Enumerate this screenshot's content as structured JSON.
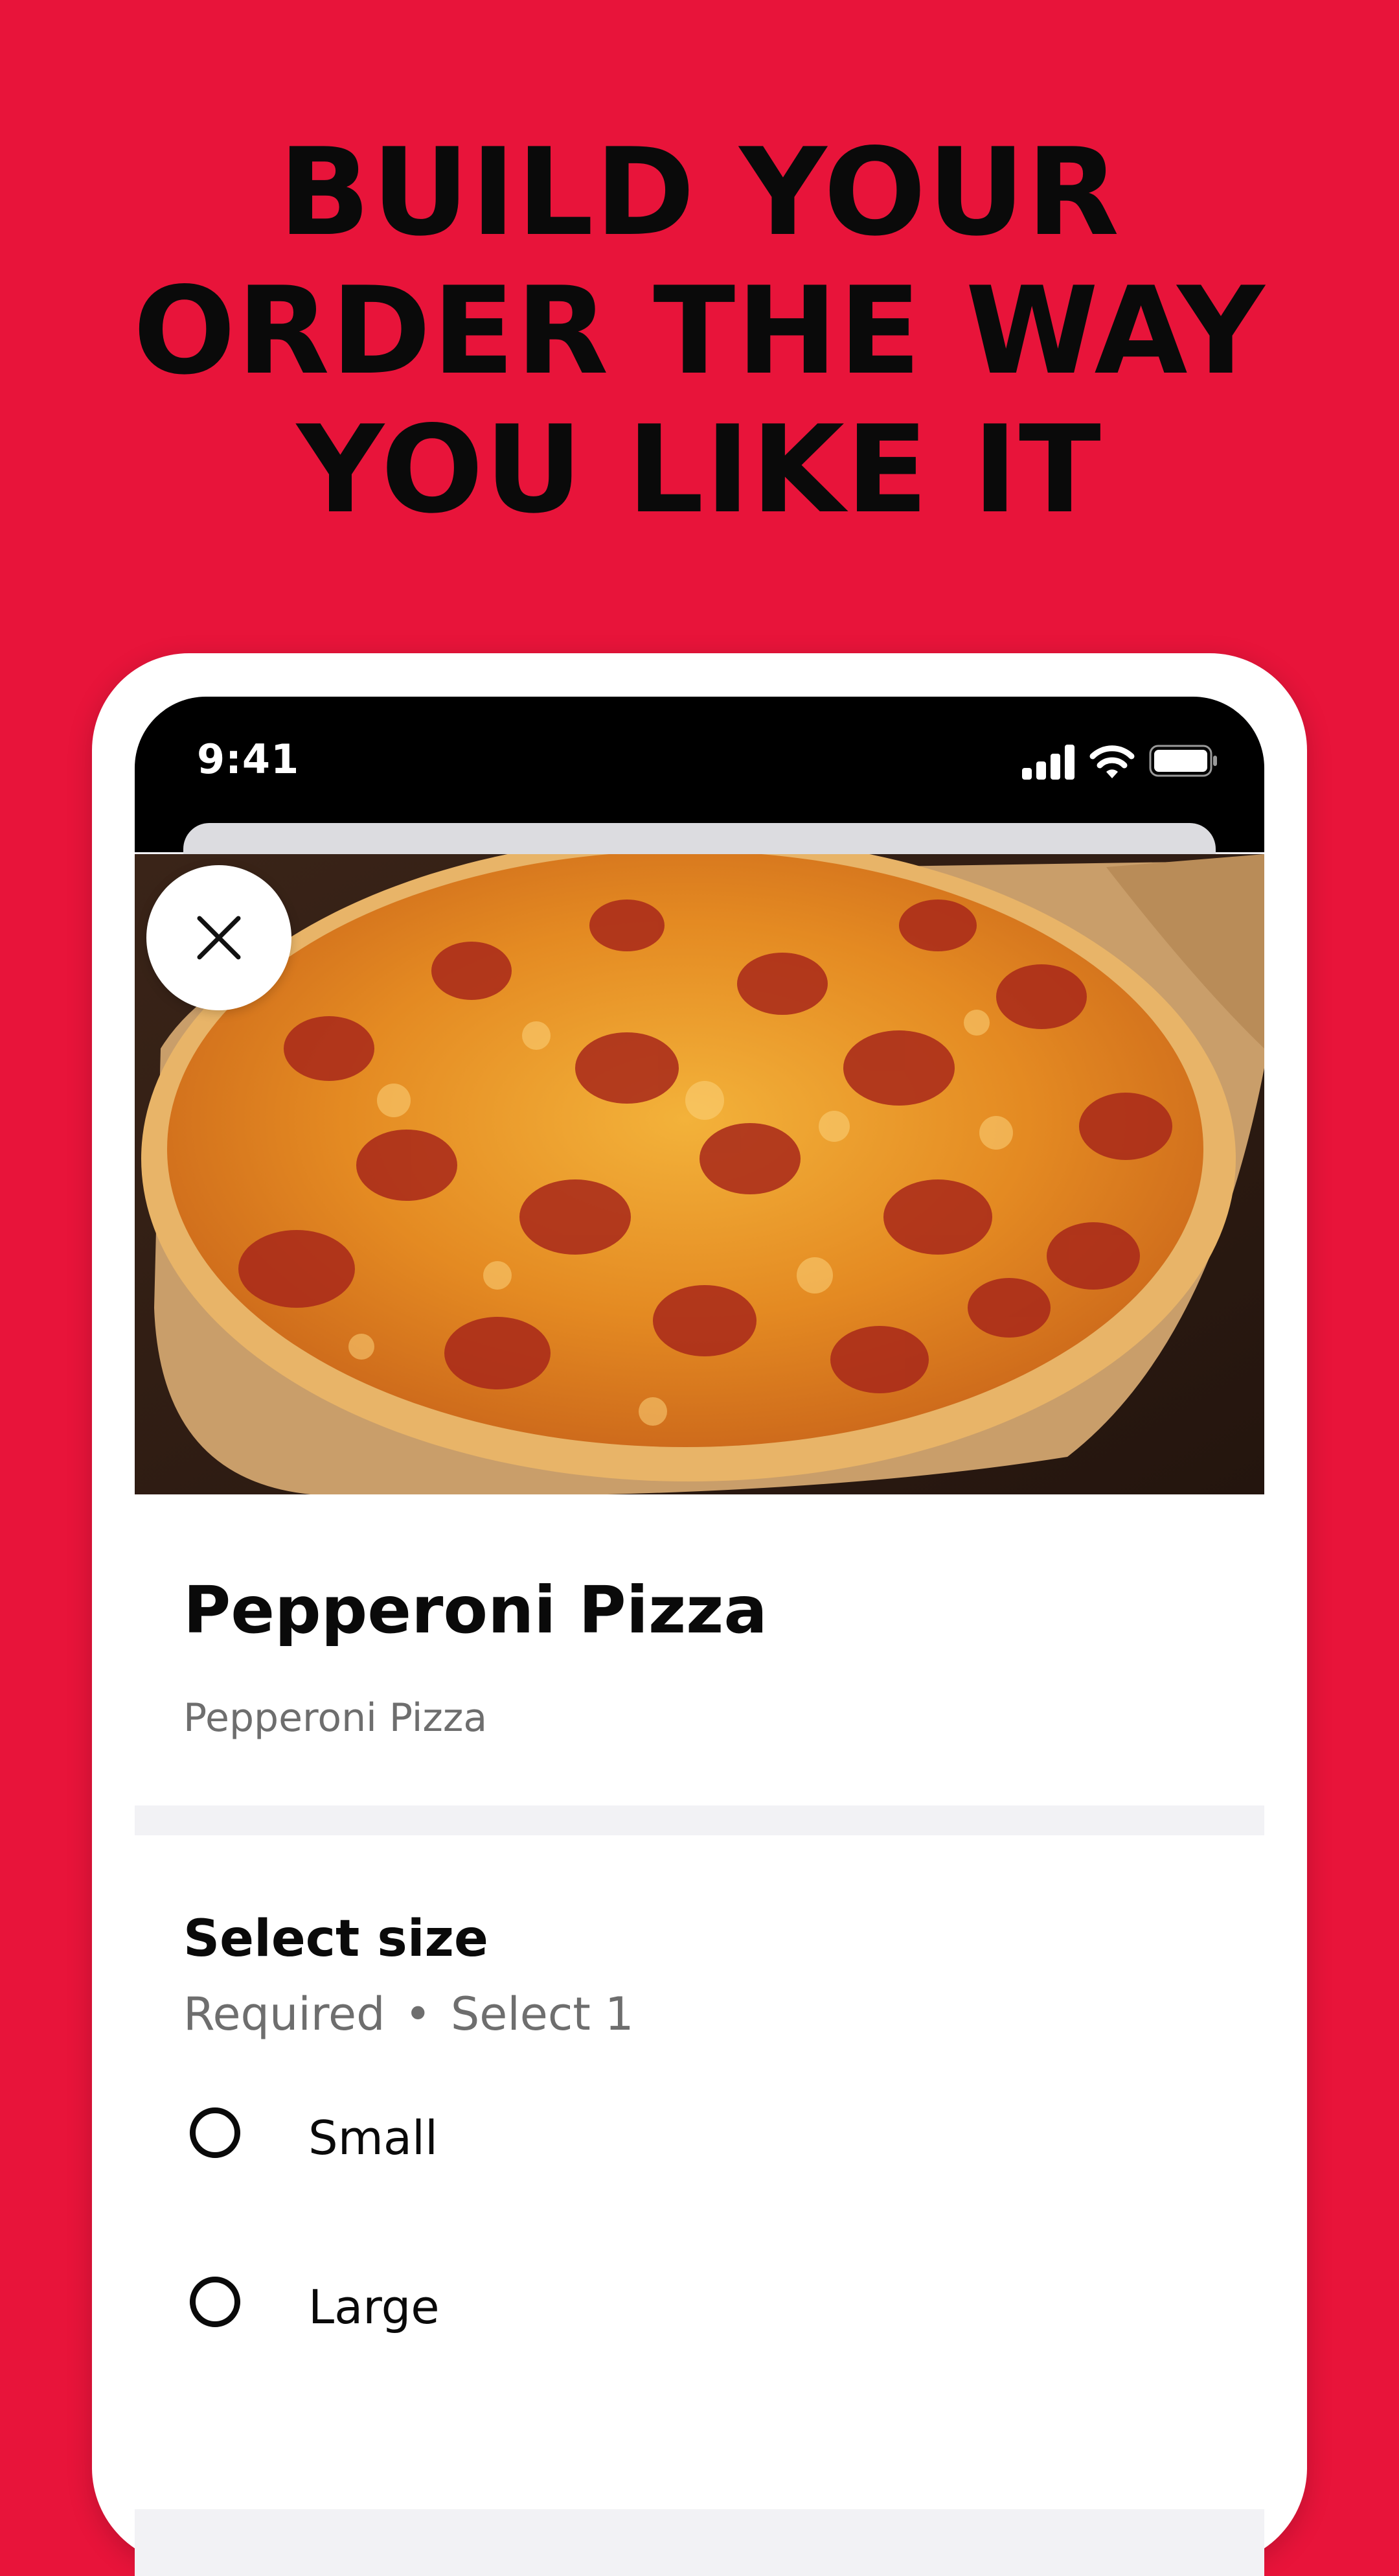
{
  "headline": {
    "line1": "BUILD YOUR",
    "line2": "ORDER THE WAY",
    "line3": "YOU LIKE IT"
  },
  "status_bar": {
    "time": "9:41",
    "icons": [
      "signal-icon",
      "wifi-icon",
      "battery-icon"
    ]
  },
  "item": {
    "image": "pepperoni-pizza-photo",
    "name": "Pepperoni Pizza",
    "description": "Pepperoni Pizza"
  },
  "close_icon": "close-icon",
  "size_selector": {
    "title": "Select size",
    "required_label": "Required",
    "separator": "•",
    "select_hint": "Select 1",
    "options": [
      {
        "label": "Small",
        "selected": false
      },
      {
        "label": "Large",
        "selected": false
      }
    ]
  },
  "colors": {
    "background": "#e8143a",
    "headline_text": "#0a0a0a",
    "secondary_text": "#6e6e6e"
  }
}
